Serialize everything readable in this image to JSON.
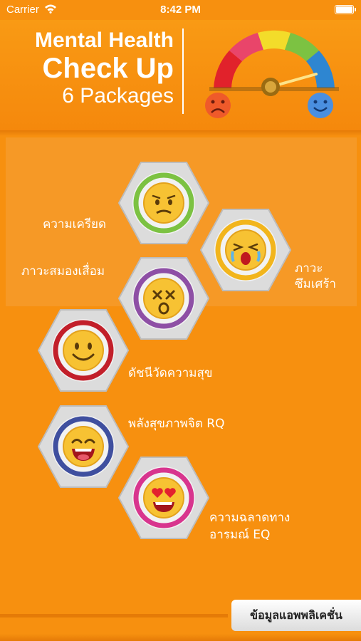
{
  "status_bar": {
    "carrier": "Carrier",
    "time": "8:42 PM"
  },
  "header": {
    "title_line1": "Mental Health",
    "title_line2": "Check Up",
    "title_line3": "6 Packages"
  },
  "packages": [
    {
      "label": "ความเครียด",
      "icon": "worried-face-icon",
      "ring_color": "#7cc242"
    },
    {
      "label_line1": "ภาวะ",
      "label_line2": "ซึมเศร้า",
      "icon": "crying-face-icon",
      "ring_color": "#f2b51c"
    },
    {
      "label": "ภาวะสมองเสื่อม",
      "icon": "dizzy-face-icon",
      "ring_color": "#8e4fa5"
    },
    {
      "label": "ดัชนีวัดความสุข",
      "icon": "smiling-face-icon",
      "ring_color": "#c21f2a"
    },
    {
      "label": "พลังสุขภาพจิต RQ",
      "icon": "grinning-face-icon",
      "ring_color": "#3f4f9f"
    },
    {
      "label_line1": "ความฉลาดทาง",
      "label_line2": "อารมณ์ EQ",
      "icon": "heart-eyes-face-icon",
      "ring_color": "#d8358e"
    }
  ],
  "footer": {
    "info_button": "ข้อมูลแอพพลิเคชั่น"
  },
  "colors": {
    "background": "#f7900f",
    "face": "#f7c233"
  }
}
